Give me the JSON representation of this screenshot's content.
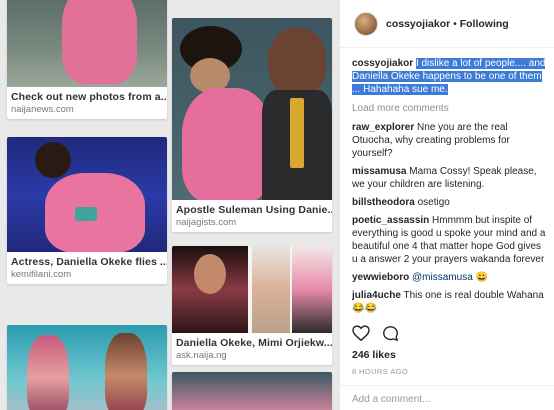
{
  "grid": {
    "col1": [
      {
        "caption": "Check out new photos from a...",
        "source": "naijanews.com"
      },
      {
        "caption": "Actress, Daniella Okeke flies ...",
        "source": "kemifilani.com"
      },
      {
        "caption": "",
        "source": ""
      }
    ],
    "col2": [
      {
        "caption": "Apostle Suleman Using Danie...",
        "source": "naijagists.com"
      },
      {
        "caption": "Daniella Okeke, Mimi Orjiekw...",
        "source": "ask.naija.ng"
      },
      {
        "caption": "",
        "source": ""
      }
    ],
    "col1_top_source_partial": "naijanews.com",
    "col2_top_source_partial": "kemifilani.com"
  },
  "instagram": {
    "header": {
      "username": "cossyojiakor",
      "separator": " • ",
      "follow_status": "Following"
    },
    "caption": {
      "username": "cossyojiakor",
      "text": "I dislike a lot of people.... and Daniella Okeke happens to be one of them ... Hahahaha sue me."
    },
    "load_more": "Load more comments",
    "comments": [
      {
        "user": "raw_explorer",
        "text": "Nne you are the real Otuocha, why creating problems for yourself?"
      },
      {
        "user": "missamusa",
        "text": "Mama Cossy! Speak please, we your children are listening."
      },
      {
        "user": "billstheodora",
        "text": "osetigo"
      },
      {
        "user": "poetic_assassin",
        "text": "Hmmmm but inspite of everything is good u spoke your mind and a beautiful one 4 that matter hope God gives u a answer 2 your prayers wakanda forever"
      },
      {
        "user": "yewwieboro",
        "mention": "@missamusa",
        "text": " 😀"
      },
      {
        "user": "julia4uche",
        "text": "This one is real double Wahana 😂😂"
      }
    ],
    "likes": "246 likes",
    "time_ago": "8 HOURS AGO",
    "add_comment_placeholder": "Add a comment..."
  }
}
